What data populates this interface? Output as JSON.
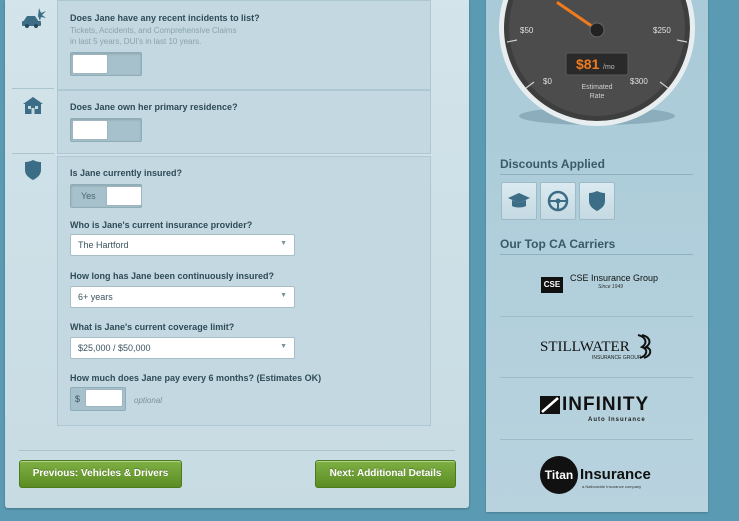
{
  "questions": {
    "incidents": {
      "label": "Does Jane have any recent incidents to list?",
      "hint_line1": "Tickets, Accidents, and Comprehensive Claims",
      "hint_line2": "in last 5 years, DUI's in last 10 years."
    },
    "residence": {
      "label": "Does Jane own her primary residence?"
    },
    "insured": {
      "label": "Is Jane currently insured?",
      "toggle_value": "Yes"
    },
    "provider": {
      "label": "Who is Jane's current insurance provider?",
      "value": "The Hartford"
    },
    "duration": {
      "label": "How long has Jane been continuously insured?",
      "value": "6+ years"
    },
    "coverage": {
      "label": "What is Jane's current coverage limit?",
      "value": "$25,000 / $50,000"
    },
    "payment": {
      "label": "How much does Jane pay every 6 months? (Estimates OK)",
      "currency": "$",
      "optional": "optional",
      "value": ""
    }
  },
  "nav": {
    "prev_label": "Previous: Vehicles & Drivers",
    "next_label": "Next: Additional Details"
  },
  "gauge": {
    "tick_50": "$50",
    "tick_250": "$250",
    "tick_0": "$0",
    "tick_300": "$300",
    "value": "$81",
    "unit": "/mo",
    "caption_line1": "Estimated",
    "caption_line2": "Rate",
    "amount": 81,
    "accent": "#f07b1e"
  },
  "discounts": {
    "title": "Discounts Applied",
    "icons": [
      "graduation-cap-icon",
      "steering-wheel-icon",
      "shield-icon"
    ]
  },
  "carriers": {
    "title": "Our Top CA Carriers",
    "list": [
      {
        "name": "CSE Insurance Group",
        "sub": "Since 1949",
        "mark": "CSE"
      },
      {
        "name": "STILLWATER",
        "sub": "INSURANCE GROUP"
      },
      {
        "name": "INFINITY",
        "sub": "Auto Insurance"
      },
      {
        "name": "Insurance",
        "mark": "Titan",
        "sub": "a Nationwide Insurance company"
      }
    ]
  },
  "colors": {
    "green_button": "#6a9c30",
    "gauge_needle": "#f07b1e",
    "background": "#5b9ab3"
  }
}
